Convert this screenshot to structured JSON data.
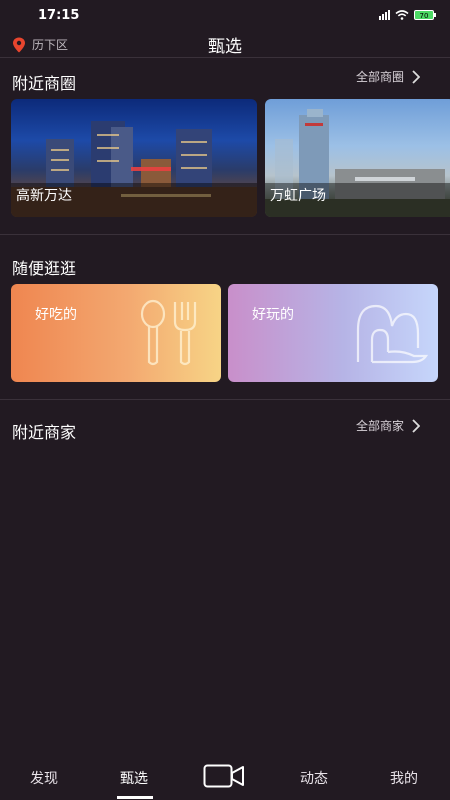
{
  "status_bar": {
    "time": "17:15",
    "battery_level": "70"
  },
  "header": {
    "location": "历下区",
    "title": "甄选"
  },
  "nearby_business_districts": {
    "title": "附近商圈",
    "link_label": "全部商圈",
    "cards": [
      {
        "label": "高新万达"
      },
      {
        "label": "万虹广场"
      }
    ]
  },
  "browse": {
    "title": "随便逛逛",
    "cards": [
      {
        "label": "好吃的",
        "icon": "spoon-fork-icon"
      },
      {
        "label": "好玩的",
        "icon": "arch-icon"
      }
    ]
  },
  "nearby_merchants": {
    "title": "附近商家",
    "link_label": "全部商家"
  },
  "tab_bar": {
    "items": [
      {
        "label": "发现"
      },
      {
        "label": "甄选",
        "active": true
      },
      {
        "label": "",
        "icon": "video-camera-icon"
      },
      {
        "label": "动态"
      },
      {
        "label": "我的"
      }
    ]
  },
  "colors": {
    "background": "#221a22",
    "location_pin": "#e8452e",
    "food_gradient_start": "#ef8650",
    "food_gradient_end": "#f7d486",
    "fun_gradient_start": "#c98fca",
    "fun_gradient_end": "#c6d6fb"
  }
}
